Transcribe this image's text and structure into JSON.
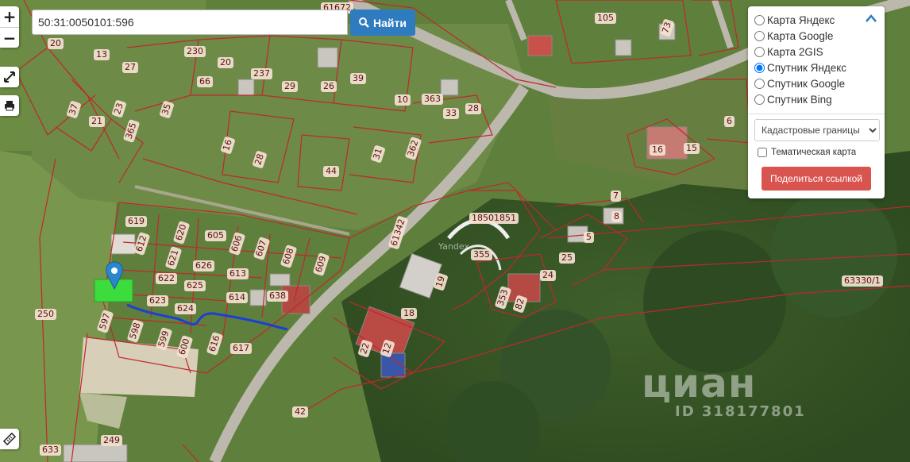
{
  "search": {
    "value": "50:31:0050101:596",
    "button_label": "Найти",
    "button_icon": "search-icon"
  },
  "controls": {
    "zoom_in": "+",
    "zoom_out": "−"
  },
  "layers": {
    "options": [
      {
        "label": "Карта Яндекс",
        "checked": false
      },
      {
        "label": "Карта Google",
        "checked": false
      },
      {
        "label": "Карта 2GIS",
        "checked": false
      },
      {
        "label": "Спутник Яндекс",
        "checked": true
      },
      {
        "label": "Спутник Google",
        "checked": false
      },
      {
        "label": "Спутник Bing",
        "checked": false
      }
    ],
    "overlay_select": "Кадастровые границы",
    "thematic_label": "Тематическая карта",
    "share_label": "Поделиться ссылкой"
  },
  "map_labels": [
    "61672",
    "20",
    "13",
    "27",
    "230",
    "20",
    "237",
    "29",
    "26",
    "39",
    "10",
    "363",
    "33",
    "28",
    "37",
    "21",
    "23",
    "365",
    "35",
    "66",
    "16",
    "28",
    "31",
    "362",
    "44",
    "105",
    "73",
    "6",
    "16",
    "15",
    "619",
    "620",
    "605",
    "606",
    "607",
    "608",
    "609",
    "612",
    "621",
    "626",
    "613",
    "622",
    "625",
    "614",
    "638",
    "623",
    "624",
    "597",
    "598",
    "599",
    "600",
    "616",
    "617",
    "250",
    "249",
    "18501851",
    "355",
    "61342",
    "5",
    "7",
    "25",
    "24",
    "353",
    "19",
    "18",
    "22",
    "12",
    "63330/1",
    "8",
    "82",
    "42",
    "633"
  ],
  "watermark": {
    "brand": "циан",
    "id": "ID 318177801",
    "provider": "Yandex"
  },
  "colors": {
    "accent": "#2f7bbf",
    "share": "#d9534f",
    "boundary": "#c0282d",
    "selected_plot": "#3ddc3d",
    "route": "#1c3fd4"
  }
}
